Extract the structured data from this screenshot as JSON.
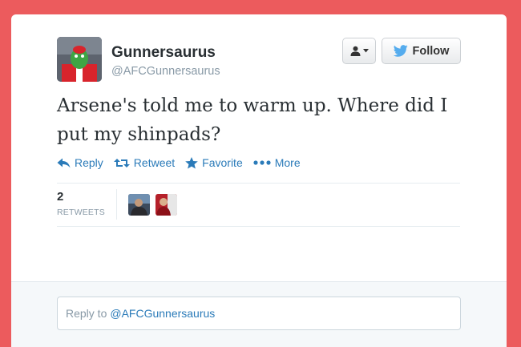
{
  "user": {
    "display_name": "Gunnersaurus",
    "handle": "@AFCGunnersaurus"
  },
  "buttons": {
    "follow_label": "Follow"
  },
  "tweet": {
    "text": "Arsene's told me to warm up. Where did I put my shinpads?"
  },
  "actions": {
    "reply": "Reply",
    "retweet": "Retweet",
    "favorite": "Favorite",
    "more": "More"
  },
  "stats": {
    "retweet_count": "2",
    "retweet_label": "RETWEETS"
  },
  "reply_box": {
    "prefix": "Reply to",
    "mention": "@AFCGunnersaurus"
  },
  "icons": {
    "user": "user-icon",
    "caret": "caret-down-icon",
    "bird": "twitter-bird-icon",
    "reply": "reply-arrow-icon",
    "retweet": "retweet-icon",
    "favorite": "star-icon",
    "more": "more-dots-icon"
  },
  "colors": {
    "background": "#ec5b5d",
    "link_blue": "#2b7bb9",
    "bird_blue": "#55acee",
    "text_dark": "#292f33",
    "text_muted": "#8899a6"
  }
}
